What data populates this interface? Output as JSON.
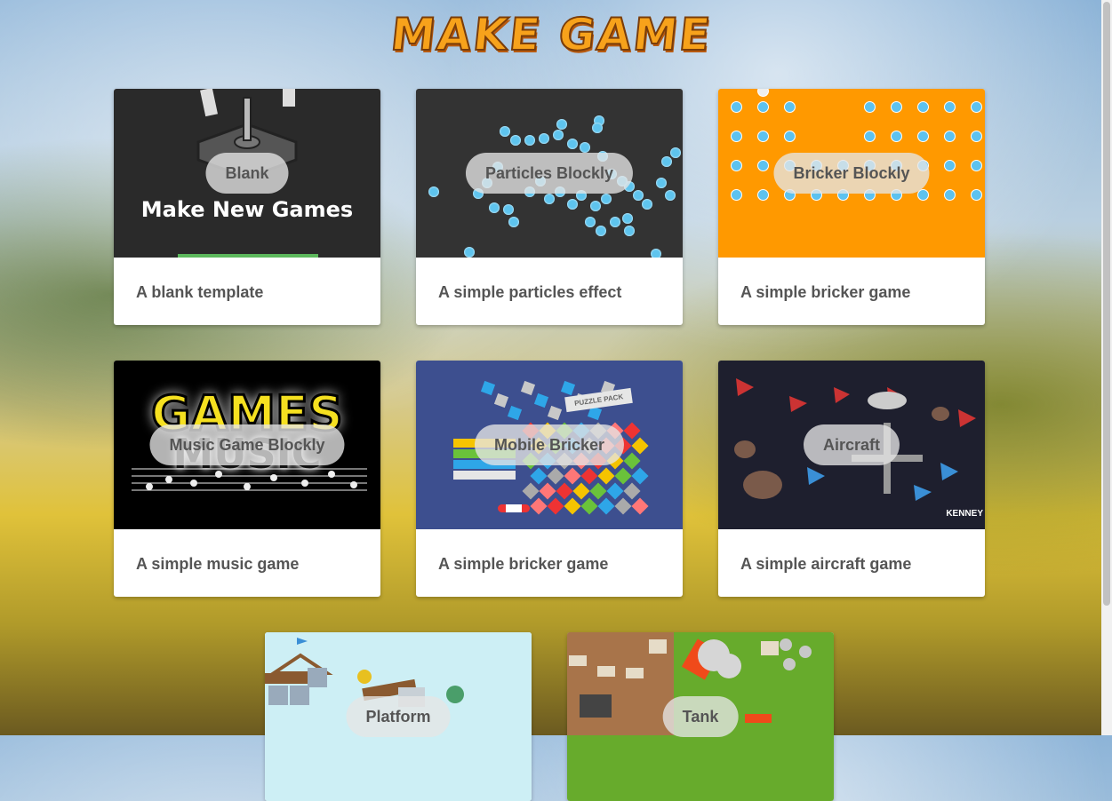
{
  "app": {
    "title": "MAKE GAME"
  },
  "cards": [
    {
      "title": "Blank",
      "description": "A blank template",
      "thumb_caption": "Make New Games"
    },
    {
      "title": "Particles Blockly",
      "description": "A simple particles effect"
    },
    {
      "title": "Bricker Blockly",
      "description": "A simple bricker game"
    },
    {
      "title": "Music Game Blockly",
      "description": "A simple music game",
      "thumb_caption_top": "GAMES",
      "thumb_caption_bottom": "MUSIC"
    },
    {
      "title": "Mobile Bricker",
      "description": "A simple bricker game",
      "thumb_caption": "PUZZLE PACK"
    },
    {
      "title": "Aircraft",
      "description": "A simple aircraft game",
      "thumb_caption": "KENNEY"
    },
    {
      "title": "Platform",
      "description": ""
    },
    {
      "title": "Tank",
      "description": ""
    }
  ],
  "colors": {
    "logo": "#f7a21b",
    "card_text": "#555555",
    "bricker_bg": "#ff9900",
    "mobile_bg": "#3d4f8f"
  }
}
